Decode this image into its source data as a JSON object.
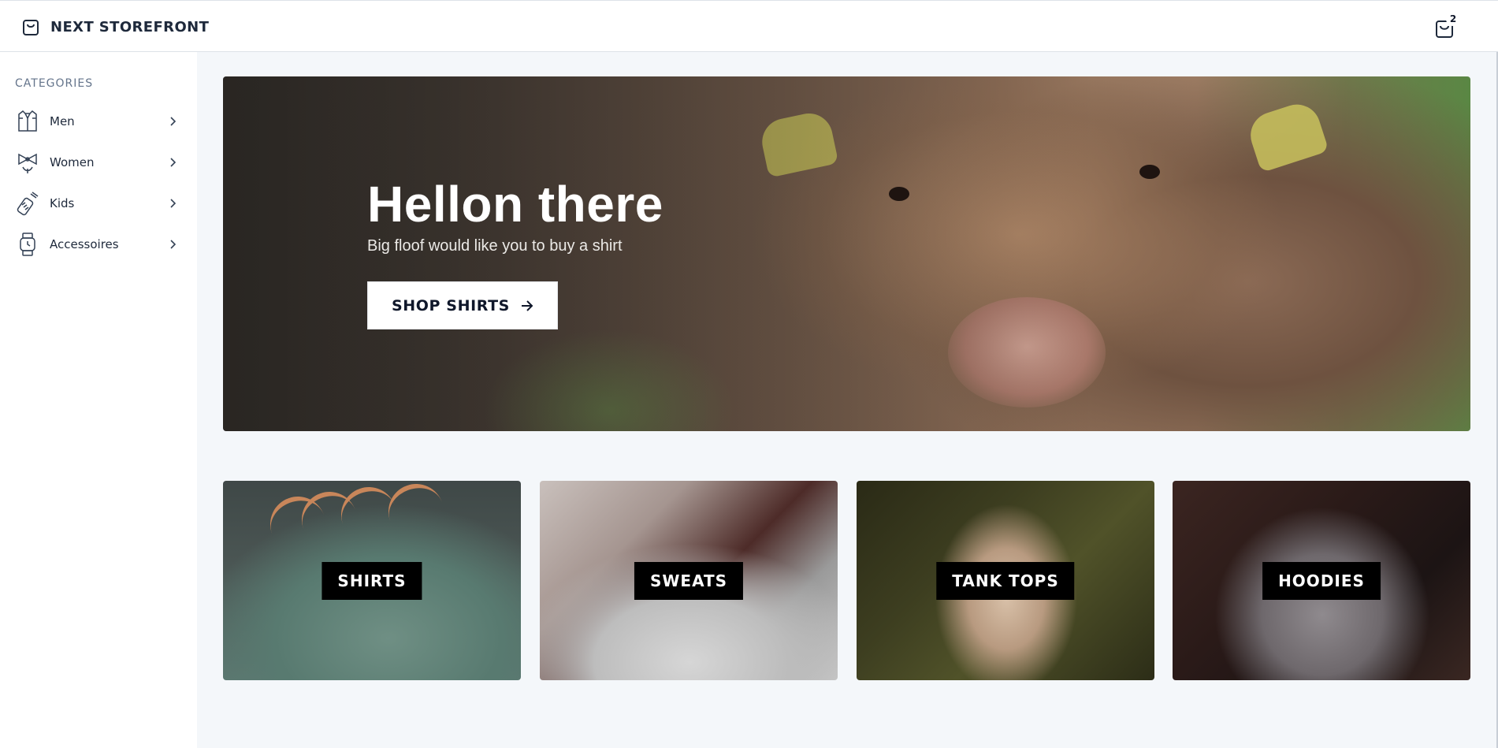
{
  "header": {
    "brand": "NEXT STOREFRONT",
    "brand_icon": "shopping-bag-icon",
    "cart_icon": "cart-bag-icon",
    "cart_count": "2"
  },
  "sidebar": {
    "heading": "CATEGORIES",
    "items": [
      {
        "label": "Men",
        "icon": "shirt-icon"
      },
      {
        "label": "Women",
        "icon": "bow-icon"
      },
      {
        "label": "Kids",
        "icon": "baby-bottle-icon"
      },
      {
        "label": "Accessoires",
        "icon": "watch-icon"
      }
    ]
  },
  "hero": {
    "title": "Hellon there",
    "subtitle": "Big floof would like you to buy a shirt",
    "button_label": "SHOP SHIRTS",
    "button_icon": "arrow-right-icon"
  },
  "collections": [
    {
      "label": "SHIRTS"
    },
    {
      "label": "SWEATS"
    },
    {
      "label": "TANK TOPS"
    },
    {
      "label": "HOODIES"
    }
  ]
}
